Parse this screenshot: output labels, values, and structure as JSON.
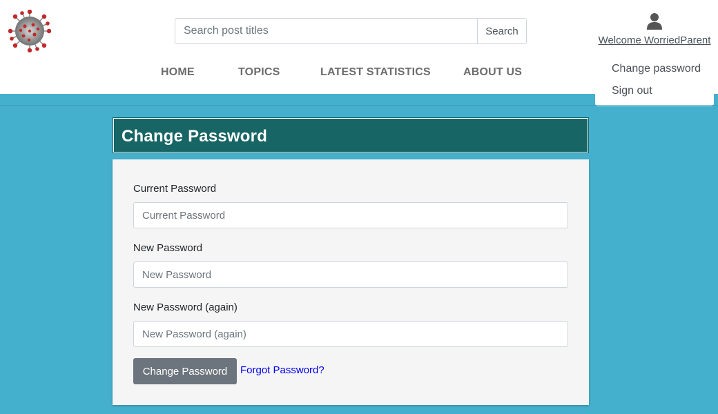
{
  "header": {
    "logo_icon": "coronavirus-logo-icon",
    "search": {
      "placeholder": "Search post titles",
      "value": "",
      "button_label": "Search"
    },
    "nav": [
      "HOME",
      "TOPICS",
      "LATEST STATISTICS",
      "ABOUT US"
    ],
    "user": {
      "icon": "user-icon",
      "welcome": "Welcome WorriedParent",
      "menu": [
        "Change password",
        "Sign out"
      ]
    }
  },
  "form": {
    "title": "Change Password",
    "fields": [
      {
        "label": "Current Password",
        "placeholder": "Current Password",
        "value": ""
      },
      {
        "label": "New Password",
        "placeholder": "New Password",
        "value": ""
      },
      {
        "label": "New Password (again)",
        "placeholder": "New Password (again)",
        "value": ""
      }
    ],
    "submit_label": "Change Password",
    "forgot_link": "Forgot Password?"
  },
  "colors": {
    "page_background": "#44b0cd",
    "title_bar": "#186565",
    "button": "#6c757d",
    "link": "#0000ee"
  }
}
